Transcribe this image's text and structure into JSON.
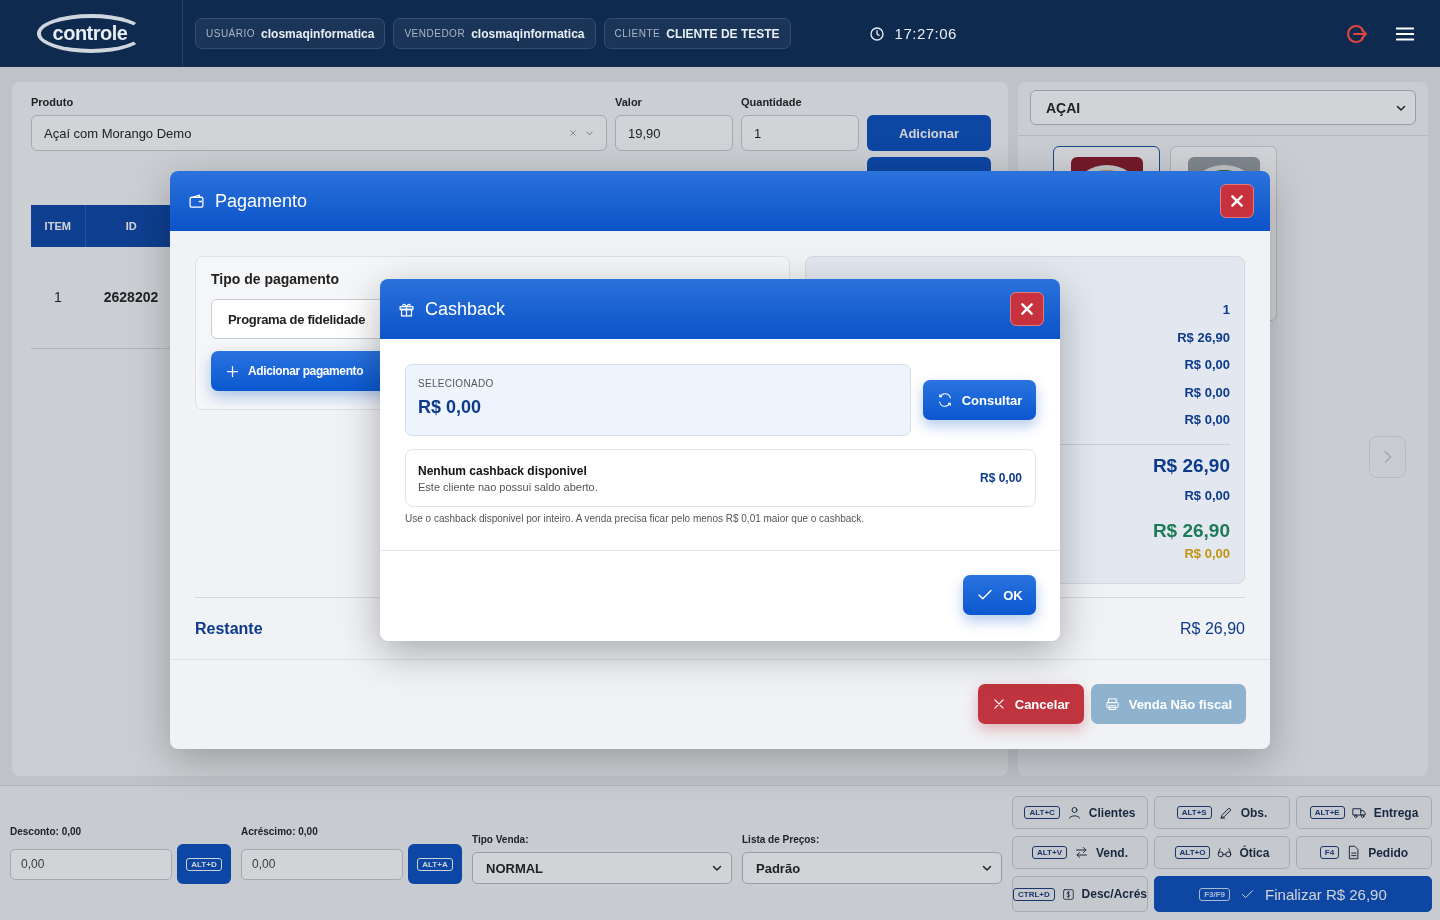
{
  "header": {
    "logo": "controle",
    "badges": [
      {
        "label": "USUÁRIO",
        "value": "closmaqinformatica"
      },
      {
        "label": "VENDEDOR",
        "value": "closmaqinformatica"
      },
      {
        "label": "CLIENTE",
        "value": "CLIENTE DE TESTE"
      }
    ],
    "clock": "17:27:06"
  },
  "product_form": {
    "fields": [
      {
        "label": "Produto",
        "value": "Açaí com Morango Demo",
        "kind": "select"
      },
      {
        "label": "Valor",
        "value": "19,90",
        "kind": "input"
      },
      {
        "label": "Quantidade",
        "value": "1",
        "kind": "input"
      }
    ],
    "add_button": "Adicionar"
  },
  "items_table": {
    "columns": [
      "ITEM",
      "ID"
    ],
    "rows": [
      [
        "1",
        "2628202"
      ]
    ]
  },
  "category_select": {
    "value": "AÇAI"
  },
  "product_tiles": [
    {
      "kind": "picture",
      "selected": true
    },
    {
      "kind": "picture",
      "selected": false
    }
  ],
  "payment_modal": {
    "title": "Pagamento",
    "payment_type_label": "Tipo de pagamento",
    "payment_type": "Programa de fidelidade",
    "add_payment_button": "Adicionar pagamento",
    "summary_values": [
      {
        "value": "1",
        "kind": "line",
        "color": "#0d3a8a"
      },
      {
        "value": "R$ 26,90",
        "kind": "line",
        "color": "#0d3a8a"
      },
      {
        "value": "R$ 0,00",
        "kind": "line",
        "color": "#0d3a8a"
      },
      {
        "value": "R$ 0,00",
        "kind": "line",
        "color": "#0d3a8a"
      },
      {
        "value": "R$ 0,00",
        "kind": "line",
        "color": "#0d3a8a"
      },
      {
        "value": "R$ 26,90",
        "kind": "total",
        "color": "#0d3a8a"
      },
      {
        "value": "R$ 0,00",
        "kind": "line",
        "color": "#0d3a8a"
      },
      {
        "value": "R$ 26,90",
        "kind": "total",
        "color": "#1e7a57"
      },
      {
        "value": "R$ 0,00",
        "kind": "line",
        "color": "#c2940e"
      }
    ],
    "remaining_label": "Restante",
    "remaining_value": "R$ 26,90",
    "buttons": [
      {
        "label": "Cancelar",
        "kind": "danger"
      },
      {
        "label": "Venda Não fiscal",
        "kind": "secondary"
      }
    ]
  },
  "cashback_modal": {
    "title": "Cashback",
    "selected_label": "SELECIONADO",
    "selected_value": "R$ 0,00",
    "consult_button": "Consultar",
    "entry": {
      "title": "Nenhum cashback disponivel",
      "subtitle": "Este cliente nao possui saldo aberto.",
      "amount": "R$ 0,00"
    },
    "note": "Use o cashback disponivel por inteiro. A venda precisa ficar pelo menos R$ 0,01 maior que o cashback.",
    "ok_button": "OK"
  },
  "bottom_bar": {
    "adjustments": [
      {
        "label": "Desconto: 0,00",
        "value": "0,00",
        "key": "ALT+D"
      },
      {
        "label": "Acréscimo: 0,00",
        "value": "0,00",
        "key": "ALT+A"
      }
    ],
    "selects": [
      {
        "label": "Tipo Venda:",
        "value": "NORMAL"
      },
      {
        "label": "Lista de Preços:",
        "value": "Padrão"
      }
    ],
    "shortcuts": [
      {
        "key": "ALT+C",
        "label": "Clientes",
        "kind": "plain"
      },
      {
        "key": "ALT+S",
        "label": "Obs.",
        "kind": "plain"
      },
      {
        "key": "ALT+E",
        "label": "Entrega",
        "kind": "plain"
      },
      {
        "key": "ALT+V",
        "label": "Vend.",
        "kind": "plain"
      },
      {
        "key": "ALT+O",
        "label": "Ótica",
        "kind": "plain"
      },
      {
        "key": "F4",
        "label": "Pedido",
        "kind": "plain"
      },
      {
        "key": "CTRL+D",
        "label": "Desc/Acrés",
        "kind": "plain"
      },
      {
        "key": "F3/F9",
        "label": "Finalizar R$ 26,90",
        "kind": "primary"
      }
    ]
  }
}
